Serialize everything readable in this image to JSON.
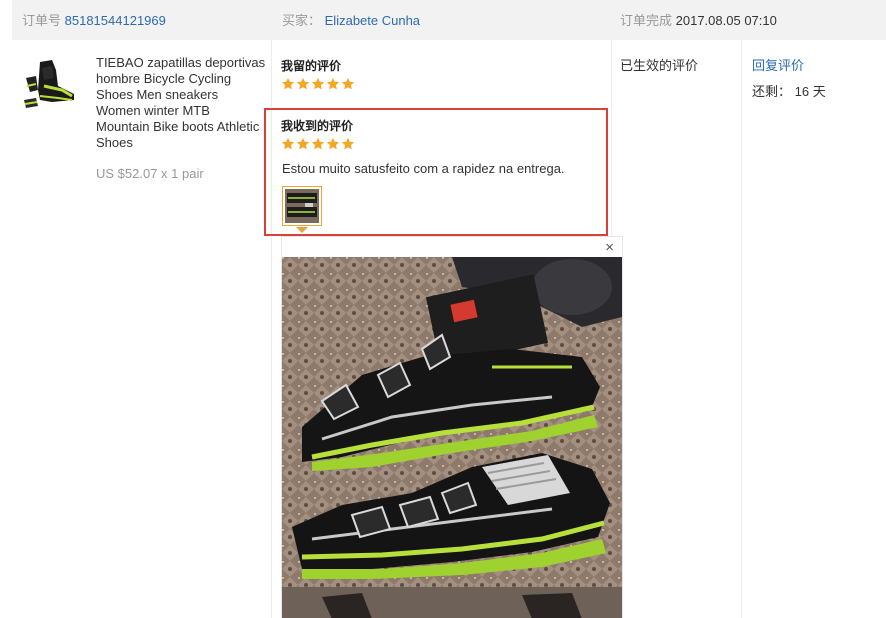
{
  "header": {
    "order_label": "订单号",
    "order_number": "85181544121969",
    "buyer_label": "买家：",
    "buyer_name": "Elizabete Cunha",
    "completed_label": "订单完成",
    "completed_time": "2017.08.05 07:10"
  },
  "product": {
    "title": "TIEBAO zapatillas deportivas hombre Bicycle Cycling Shoes Men sneakers Women winter MTB Mountain Bike boots Athletic Shoes",
    "price_line": "US $52.07 x 1 pair"
  },
  "my_review": {
    "title": "我留的评价",
    "rating": 5
  },
  "received_review": {
    "title": "我收到的评价",
    "rating": 5,
    "text": "Estou muito satusfeito com a rapidez na entrega."
  },
  "viewer": {
    "close_symbol": "×"
  },
  "status": {
    "effective_label": "已生效的评价"
  },
  "actions": {
    "reply_label": "回复评价",
    "remaining_label": "还剩：",
    "remaining_value": "16 天"
  },
  "colors": {
    "link": "#2d6ab0",
    "star": "#f5a623",
    "highlight_border": "#d8413a",
    "header_bg": "#f2f2f2"
  }
}
